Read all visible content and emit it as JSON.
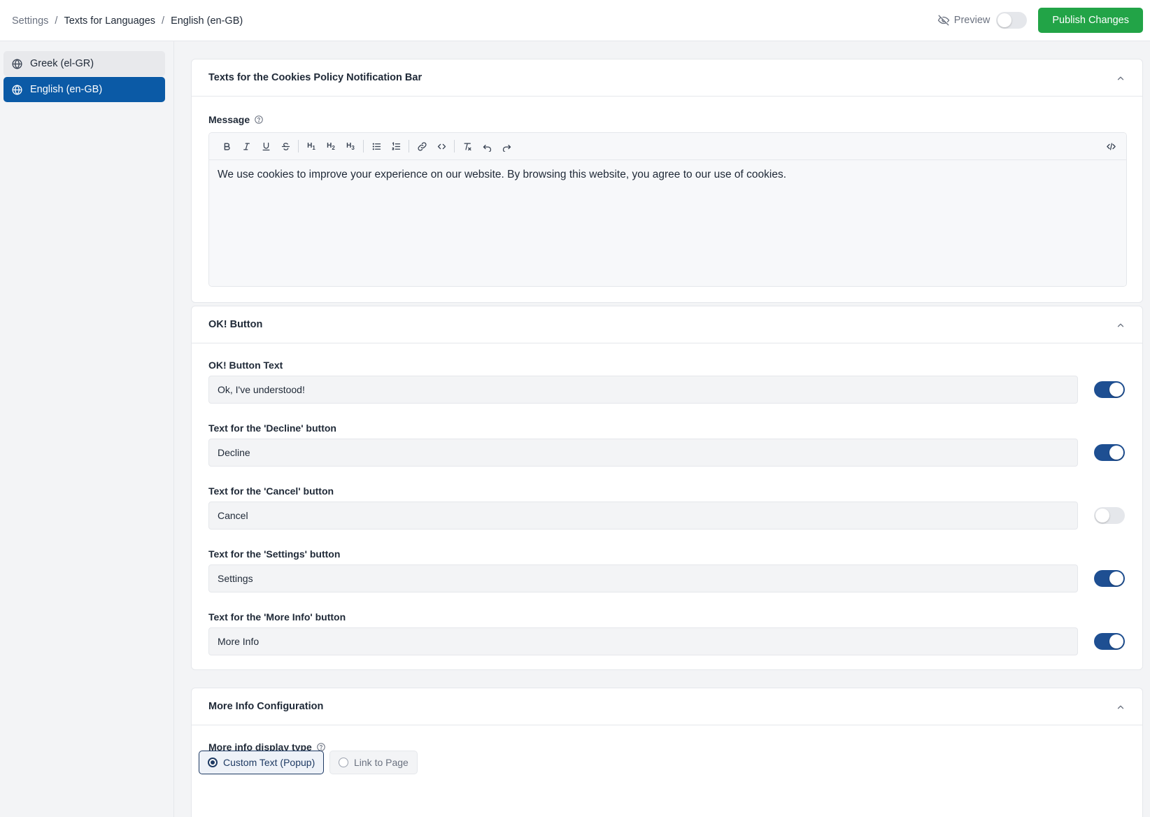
{
  "breadcrumb": {
    "root": "Settings",
    "section": "Texts for Languages",
    "current": "English (en-GB)",
    "separator": "/"
  },
  "header": {
    "preview_label": "Preview",
    "preview_enabled": false,
    "publish_label": "Publish Changes",
    "publish_color": "#22a447"
  },
  "sidebar": {
    "items": [
      {
        "label": "Greek (el-GR)",
        "icon": "globe-icon",
        "active": false
      },
      {
        "label": "English (en-GB)",
        "icon": "globe-icon",
        "active": true
      }
    ],
    "active_color": "#0b5aa6"
  },
  "cookies_bar": {
    "title": "Texts for the Cookies Policy Notification Bar",
    "message_label": "Message",
    "toolbar": {
      "h1": "H",
      "h1_sub": "1",
      "h2": "H",
      "h2_sub": "2",
      "h3": "H",
      "h3_sub": "3",
      "icons": [
        "bold-icon",
        "italic-icon",
        "underline-icon",
        "strikethrough-icon",
        "heading-1-icon",
        "heading-2-icon",
        "heading-3-icon",
        "bullet-list-icon",
        "ordered-list-icon",
        "link-icon",
        "code-icon",
        "clear-format-icon",
        "undo-icon",
        "redo-icon",
        "source-code-icon"
      ]
    },
    "message_text": "We use cookies to improve your experience on our website. By browsing this website, you agree to our use of cookies."
  },
  "ok_button_section": {
    "title": "OK! Button",
    "fields": [
      {
        "label": "OK! Button Text",
        "value": "Ok, I've understood!",
        "enabled": true
      },
      {
        "label": "Text for the 'Decline' button",
        "value": "Decline",
        "enabled": true
      },
      {
        "label": "Text for the 'Cancel' button",
        "value": "Cancel",
        "enabled": false
      },
      {
        "label": "Text for the 'Settings' button",
        "value": "Settings",
        "enabled": true
      },
      {
        "label": "Text for the 'More Info' button",
        "value": "More Info",
        "enabled": true
      }
    ],
    "toggle_on_color": "#1e4f92"
  },
  "more_info_config": {
    "title": "More Info Configuration",
    "display_type_label": "More info display type",
    "options": [
      {
        "label": "Custom Text (Popup)",
        "selected": true
      },
      {
        "label": "Link to Page",
        "selected": false
      }
    ]
  }
}
